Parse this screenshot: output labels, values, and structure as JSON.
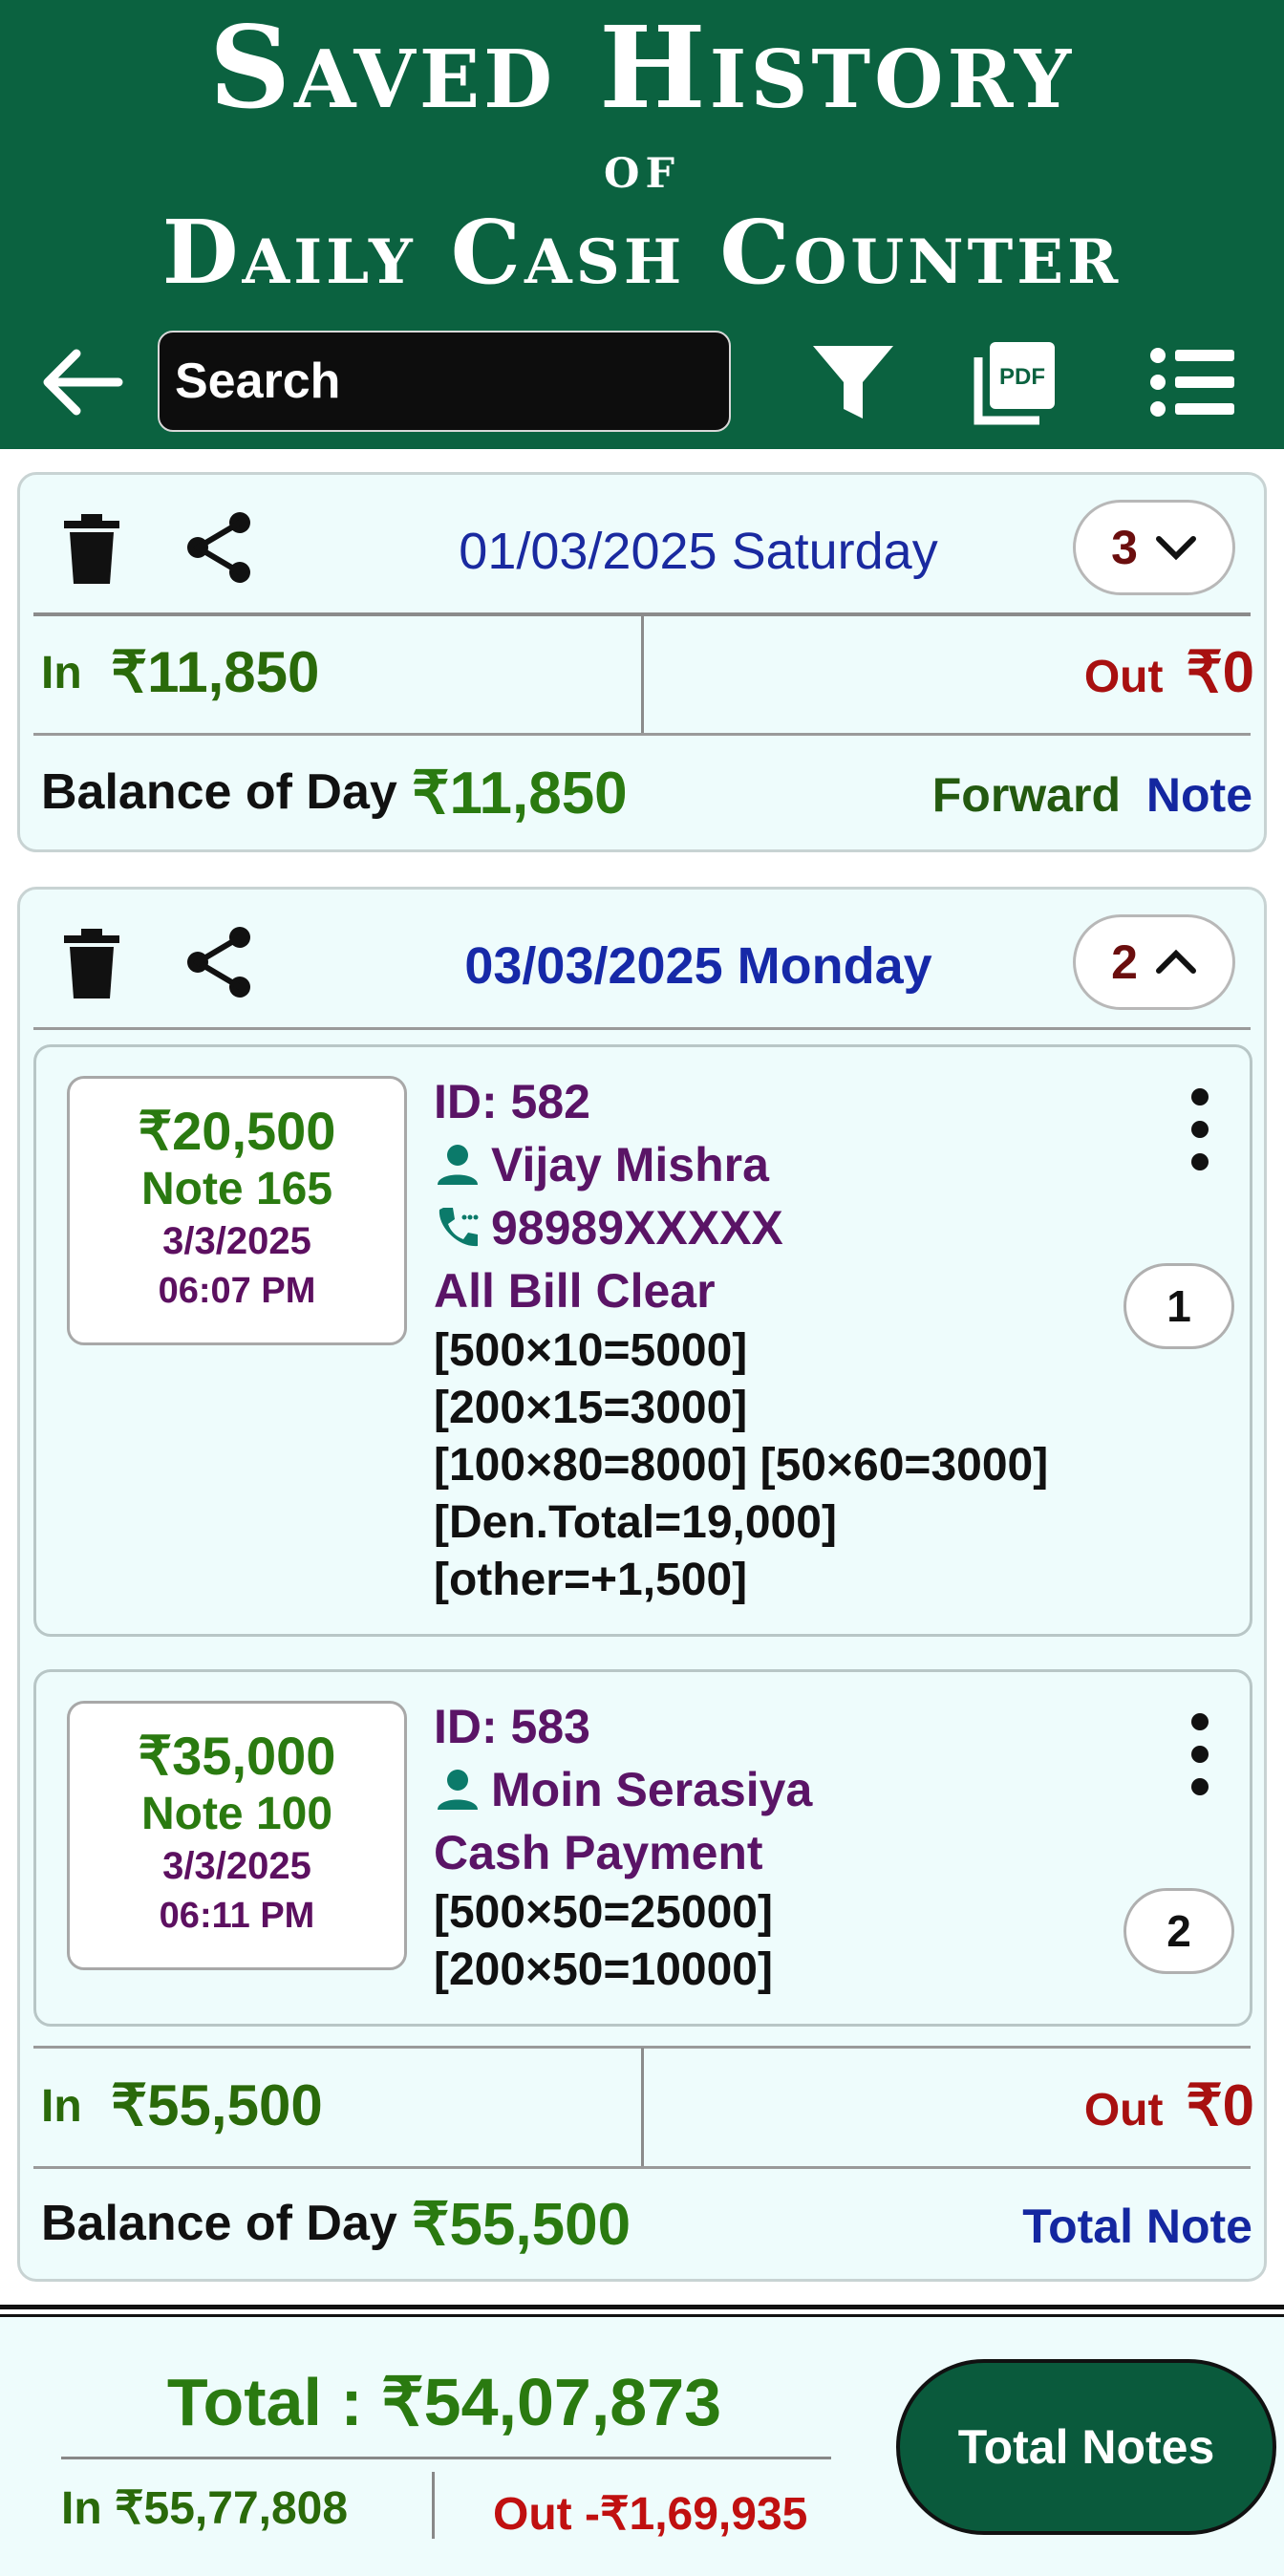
{
  "header": {
    "title_line1": "Saved History",
    "title_line2": "of",
    "title_line3": "Daily Cash Counter",
    "search_placeholder": "Search",
    "pdf_label": "PDF"
  },
  "days": [
    {
      "date": "01/03/2025 Saturday",
      "count": "3",
      "in_label": "In",
      "in_amount": "₹11,850",
      "out_label": "Out",
      "out_amount": "₹0",
      "balance_label": "Balance of Day",
      "balance_amount": "₹11,850",
      "forward_label": "Forward",
      "note_label": "Note"
    },
    {
      "date": "03/03/2025 Monday",
      "count": "2",
      "in_label": "In",
      "in_amount": "₹55,500",
      "out_label": "Out",
      "out_amount": "₹0",
      "balance_label": "Balance of Day",
      "balance_amount": "₹55,500",
      "total_note_label": "Total Note",
      "entries": [
        {
          "amount": "₹20,500",
          "note": "Note 165",
          "date": "3/3/2025",
          "time": "06:07 PM",
          "id": "ID: 582",
          "name": "Vijay Mishra",
          "phone": "98989XXXXX",
          "remark": "All Bill Clear",
          "den_lines": [
            "[500×10=5000]",
            "[200×15=3000]",
            "[100×80=8000] [50×60=3000]",
            "[Den.Total=19,000]",
            "[other=+1,500]"
          ],
          "index": "1"
        },
        {
          "amount": "₹35,000",
          "note": "Note 100",
          "date": "3/3/2025",
          "time": "06:11 PM",
          "id": "ID: 583",
          "name": "Moin Serasiya",
          "remark": "Cash Payment",
          "den_lines": [
            "[500×50=25000]",
            "[200×50=10000]"
          ],
          "index": "2"
        }
      ]
    }
  ],
  "footer": {
    "total": "Total : ₹54,07,873",
    "in": "In ₹55,77,808",
    "out": "Out -₹1,69,935",
    "total_notes_button": "Total Notes"
  },
  "colors": {
    "header_bg": "#0b6240",
    "card_bg": "#eefcfc",
    "in_green": "#2a6a0a",
    "out_red": "#a81010",
    "date_blue": "#1a2aa0",
    "name_purple": "#5a1466"
  }
}
